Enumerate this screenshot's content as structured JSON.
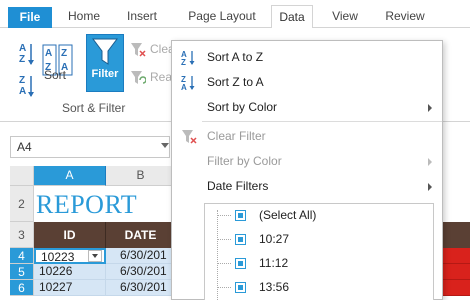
{
  "ribbon": {
    "tabs": [
      "File",
      "Home",
      "Insert",
      "Page Layout",
      "Data",
      "View",
      "Review"
    ],
    "active_tab": "Data",
    "sort_label": "Sort",
    "filter_label": "Filter",
    "clear_label": "Clea",
    "reapply_label": "Rea",
    "group_label": "Sort & Filter",
    "accent_color": "#2a9ad8"
  },
  "namebox": {
    "value": "A4"
  },
  "sheet": {
    "columns": [
      "A",
      "B"
    ],
    "rows": [
      "2",
      "3",
      "4",
      "5",
      "6"
    ],
    "title": "REPORT",
    "headers": [
      "ID",
      "DATE"
    ],
    "data": [
      {
        "id": "10223",
        "date": "6/30/201"
      },
      {
        "id": "10226",
        "date": "6/30/201"
      },
      {
        "id": "10227",
        "date": "6/30/201"
      }
    ],
    "header_color": "#5a4034",
    "band_color": "#d9221c"
  },
  "menu": {
    "items": [
      {
        "label": "Sort A to Z",
        "icon": "sort-az-icon",
        "enabled": true,
        "submenu": false
      },
      {
        "label": "Sort Z to A",
        "icon": "sort-za-icon",
        "enabled": true,
        "submenu": false
      },
      {
        "label": "Sort by Color",
        "enabled": true,
        "submenu": true
      },
      {
        "label": "Clear Filter",
        "icon": "clear-filter-icon",
        "enabled": false,
        "submenu": false
      },
      {
        "label": "Filter by Color",
        "enabled": false,
        "submenu": true
      },
      {
        "label": "Date Filters",
        "enabled": true,
        "submenu": true
      }
    ],
    "list": [
      "(Select All)",
      "10:27",
      "11:12",
      "13:56"
    ]
  }
}
